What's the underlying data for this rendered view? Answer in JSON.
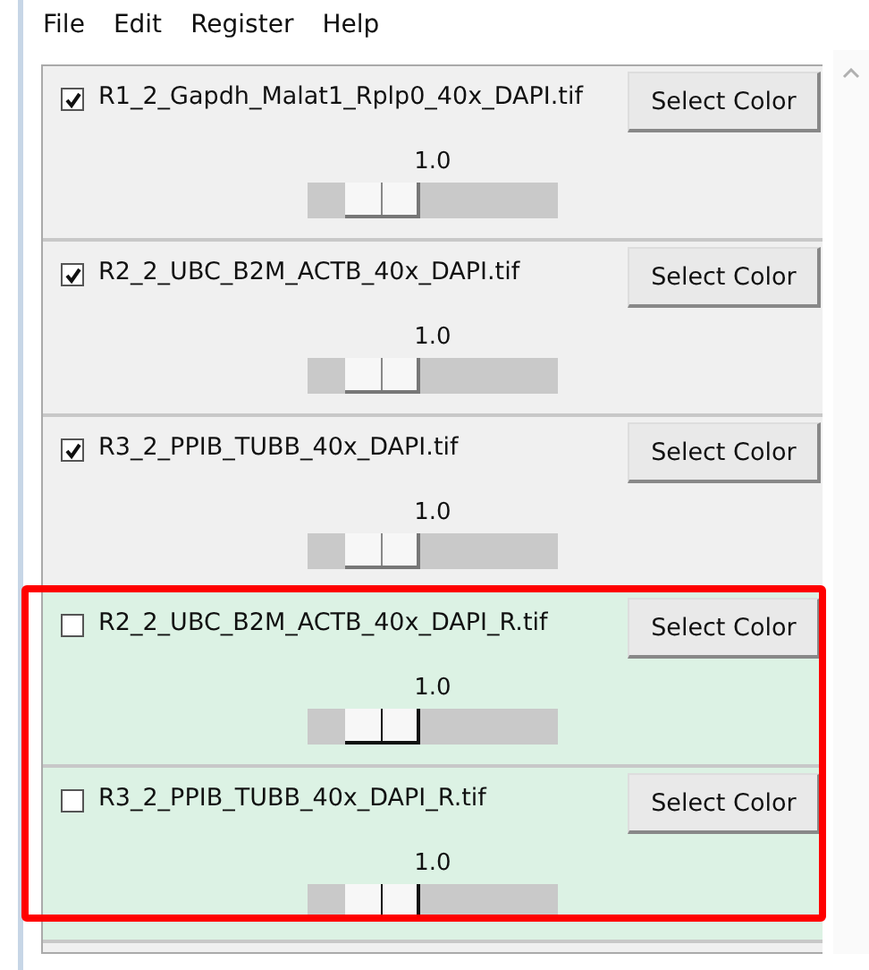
{
  "menu": [
    {
      "label": "File"
    },
    {
      "label": "Edit"
    },
    {
      "label": "Register"
    },
    {
      "label": "Help"
    }
  ],
  "layers": [
    {
      "checked": true,
      "file": "R1_2_Gapdh_Malat1_Rplp0_40x_DAPI.tif",
      "button": "Select Color",
      "value": "1.0",
      "level": 0.3,
      "highlighted": false
    },
    {
      "checked": true,
      "file": "R2_2_UBC_B2M_ACTB_40x_DAPI.tif",
      "button": "Select Color",
      "value": "1.0",
      "level": 0.3,
      "highlighted": false
    },
    {
      "checked": true,
      "file": "R3_2_PPIB_TUBB_40x_DAPI.tif",
      "button": "Select Color",
      "value": "1.0",
      "level": 0.3,
      "highlighted": false
    },
    {
      "checked": false,
      "file": "R2_2_UBC_B2M_ACTB_40x_DAPI_R.tif",
      "button": "Select Color",
      "value": "1.0",
      "level": 0.3,
      "highlighted": true
    },
    {
      "checked": false,
      "file": "R3_2_PPIB_TUBB_40x_DAPI_R.tif",
      "button": "Select Color",
      "value": "1.0",
      "level": 0.3,
      "highlighted": true
    }
  ]
}
